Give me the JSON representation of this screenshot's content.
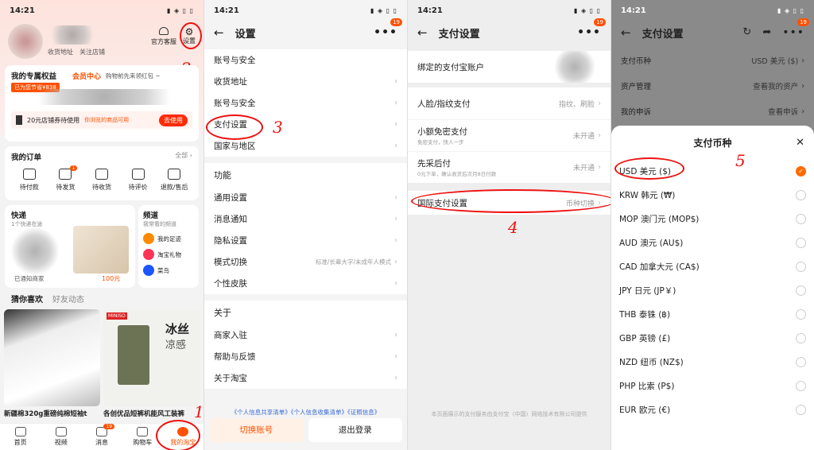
{
  "status": {
    "time": "14:21"
  },
  "p1": {
    "service": "官方客服",
    "settings": "设置",
    "shop_addr": "收货地址",
    "follow": "关注店铺",
    "rights": "我的专属权益",
    "rights_sub": "已为您节省¥838",
    "member": "会员中心",
    "member_sub": "购物前先来领红包 ~",
    "coupon_text": "20元店铺券待使用",
    "coupon_sub": "你浏览的商品可用",
    "use_btn": "去使用",
    "orders": "我的订单",
    "all": "全部 ›",
    "order_items": [
      "待付款",
      "待发货",
      "待收货",
      "待评价",
      "退款/售后"
    ],
    "order_badge": "1",
    "quick": "快递",
    "quick_sub": "1个快递在途",
    "quick_note": "已通知商家",
    "price": "100元",
    "channel": "频道",
    "channel_sub": "我常看的频道",
    "channels": [
      "我的足迹",
      "淘宝礼物",
      "菜鸟"
    ],
    "tab_like": "猜你喜欢",
    "tab_friends": "好友动态",
    "prod1": "新疆棉320g重磅纯棉短袖t",
    "prod2": "各创优品短裤机能风工装裤",
    "prod2_tag1": "冰丝",
    "prod2_tag2": "凉感",
    "brand": "MINISO",
    "tabs": [
      "首页",
      "视频",
      "消息",
      "购物车",
      "我的淘宝"
    ],
    "msg_badge": "19",
    "anno_2": "2",
    "anno_1": "1"
  },
  "p2": {
    "title": "设置",
    "badge": "19",
    "group1": [
      "账号与安全",
      "收货地址",
      "账号与安全",
      "支付设置",
      "国家与地区"
    ],
    "sec2": "功能",
    "group2": [
      "通用设置",
      "消息通知",
      "隐私设置",
      "模式切换",
      "个性皮肤"
    ],
    "mode_val": "标准/长辈大字/未成年人模式",
    "sec3": "关于",
    "group3": [
      "商家入驻",
      "帮助与反馈",
      "关于淘宝"
    ],
    "links": "《个人信息共享清单》《个人信息收集清单》《证照信息》",
    "switch": "切换账号",
    "logout": "退出登录",
    "anno_3": "3"
  },
  "p3": {
    "title": "支付设置",
    "badge": "19",
    "alipay": "绑定的支付宝账户",
    "face": "人脸/指纹支付",
    "face_val": "指纹、刷脸",
    "small": "小额免密支付",
    "small_sub": "免密支付，快人一步",
    "small_val": "未开通",
    "later": "先采后付",
    "later_sub": "0元下单，确认收货后次月8日付款",
    "later_val": "未开通",
    "intl": "国际支付设置",
    "intl_val": "币种切换",
    "footer": "本页面展示的支付服务由支付宝（中国）网络技术有限公司提供",
    "anno_4": "4"
  },
  "p4": {
    "title": "支付设置",
    "badge": "19",
    "bg_rows": [
      {
        "l": "支付币种",
        "v": "USD 美元 ($)"
      },
      {
        "l": "资产管理",
        "v": "查看我的资产"
      },
      {
        "l": "我的申诉",
        "v": "查看申诉"
      }
    ],
    "sheet_title": "支付币种",
    "close": "✕",
    "currencies": [
      "USD 美元 ($)",
      "KRW 韩元 (₩)",
      "MOP 澳门元 (MOP$)",
      "AUD 澳元 (AU$)",
      "CAD 加拿大元 (CA$)",
      "JPY 日元 (JP￥)",
      "THB 泰铢 (฿)",
      "GBP 英镑 (£)",
      "NZD 纽币 (NZ$)",
      "PHP 比索 (P$)",
      "EUR 欧元 (€)"
    ],
    "selected": "✓",
    "anno_5": "5"
  },
  "colors": {
    "accent": "#ff5000",
    "annot": "#e11111"
  }
}
